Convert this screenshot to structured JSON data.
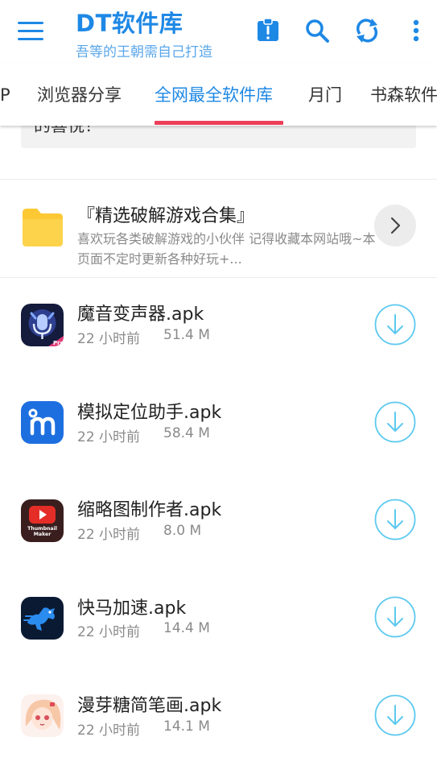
{
  "header": {
    "title": "DT软件库",
    "subtitle": "吾等的王朝需自己打造",
    "icons": [
      "menu-icon",
      "notice-icon",
      "search-icon",
      "refresh-icon",
      "more-vert-icon"
    ],
    "accent_color": "#1e88e5"
  },
  "tabs": [
    {
      "label": "P"
    },
    {
      "label": "浏览器分享"
    },
    {
      "label": "全网最全软件库",
      "active": true
    },
    {
      "label": "月门"
    },
    {
      "label": "书森软件"
    }
  ],
  "tab_indicator_color": "#ec3f5a",
  "notice": {
    "text": "的喜悦！"
  },
  "folder": {
    "title": "『精选破解游戏合集』",
    "description": "喜欢玩各类破解游戏的小伙伴 记得收藏本网站哦~本页面不定时更新各种好玩+...",
    "icon": "folder-icon"
  },
  "files": [
    {
      "name": "魔音变声器.apk",
      "time": "22 小时前",
      "size": "51.4 M",
      "icon": "voice-changer-icon"
    },
    {
      "name": "模拟定位助手.apk",
      "time": "22 小时前",
      "size": "58.4 M",
      "icon": "location-helper-icon"
    },
    {
      "name": "缩略图制作者.apk",
      "time": "22 小时前",
      "size": "8.0 M",
      "icon": "thumbnail-maker-icon"
    },
    {
      "name": "快马加速.apk",
      "time": "22 小时前",
      "size": "14.4 M",
      "icon": "horse-accelerator-icon"
    },
    {
      "name": "漫芽糖简笔画.apk",
      "time": "22 小时前",
      "size": "14.1 M",
      "icon": "anime-girl-icon"
    }
  ],
  "icon_text": {
    "pro_badge": "Pro",
    "thumbnail_line1": "Thumbnail",
    "thumbnail_line2": "Maker"
  }
}
